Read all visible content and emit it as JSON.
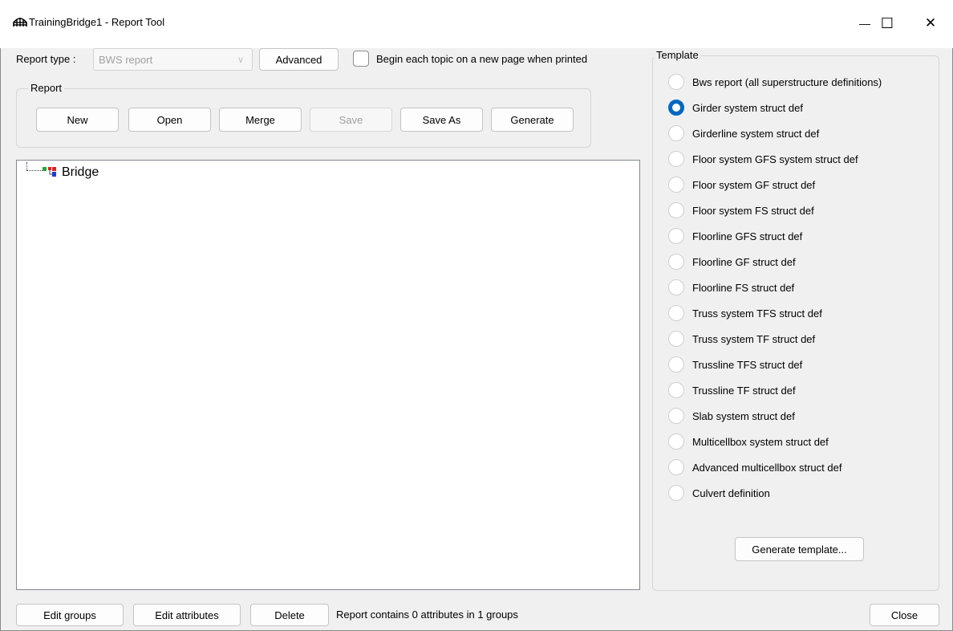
{
  "window": {
    "title": "TrainingBridge1 - Report Tool",
    "minimize_glyph": "—",
    "maximize_glyph": "☐",
    "close_glyph": "✕"
  },
  "top": {
    "report_type_label": "Report type :",
    "report_type_value": "BWS report",
    "advanced_label": "Advanced",
    "begin_topic_label": "Begin each topic on a new page when printed"
  },
  "report_group": {
    "title": "Report",
    "buttons": {
      "new": "New",
      "open": "Open",
      "merge": "Merge",
      "save": "Save",
      "save_as": "Save As",
      "generate": "Generate"
    }
  },
  "tree": {
    "root_label": "Bridge"
  },
  "template": {
    "title": "Template",
    "selected_index": 1,
    "options": [
      "Bws report (all superstructure definitions)",
      "Girder system struct def",
      "Girderline system struct def",
      "Floor system GFS system struct def",
      "Floor system GF struct def",
      "Floor system FS struct def",
      "Floorline GFS struct def",
      "Floorline GF struct def",
      "Floorline FS struct def",
      "Truss system TFS struct def",
      "Truss system TF struct def",
      "Trussline TFS struct def",
      "Trussline TF struct def",
      "Slab system struct def",
      "Multicellbox system struct def",
      "Advanced multicellbox struct def",
      "Culvert definition"
    ],
    "generate_template_label": "Generate template..."
  },
  "bottom": {
    "edit_groups": "Edit groups",
    "edit_attributes": "Edit attributes",
    "delete": "Delete",
    "status": "Report contains 0 attributes in 1 groups",
    "close": "Close"
  },
  "colors": {
    "accent": "#0067c0",
    "tree_icon_green": "#1fa83a",
    "tree_icon_red": "#e02020",
    "tree_icon_blue": "#1e3cd8"
  }
}
